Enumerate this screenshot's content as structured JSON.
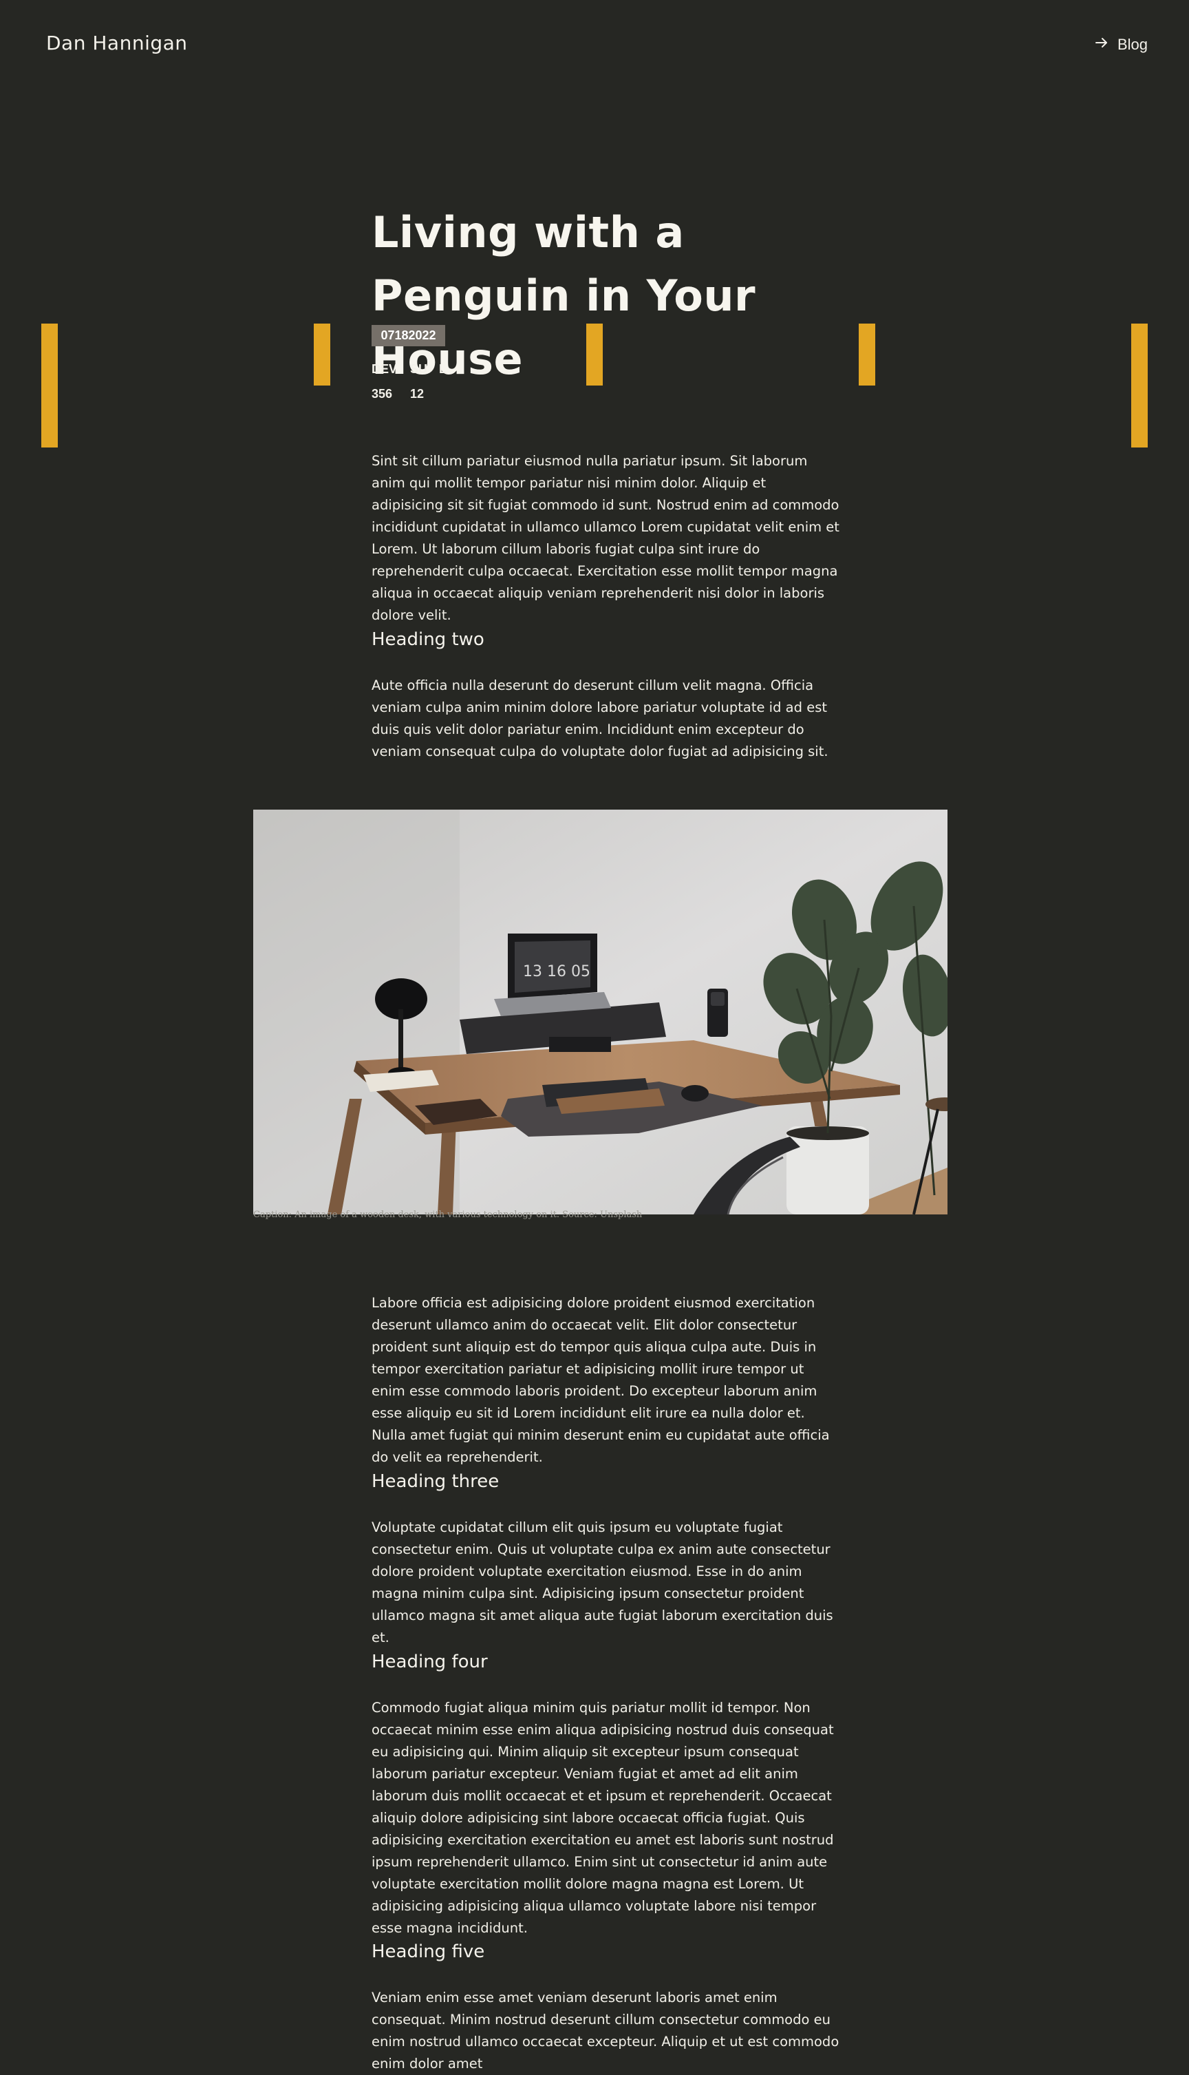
{
  "header": {
    "site_name": "Dan Hannigan",
    "blog_link": "Blog"
  },
  "colors": {
    "background": "#262723",
    "accent": "#e3a623",
    "badge": "#767069",
    "text": "#f3f1ea"
  },
  "icons": {
    "blog_link_icon": "arrow-right-icon"
  },
  "article": {
    "title": "Living with a Penguin in Your House",
    "date_badge": "07182022",
    "meta_labels": [
      "DEV",
      "SU",
      "L"
    ],
    "meta_values": [
      "356",
      "12"
    ],
    "paragraph_1": "Sint sit cillum pariatur eiusmod nulla pariatur ipsum. Sit laborum anim qui mollit tempor pariatur nisi minim dolor. Aliquip et adipisicing sit sit fugiat commodo id sunt. Nostrud enim ad commodo incididunt cupidatat in ullamco ullamco Lorem cupidatat velit enim et Lorem. Ut laborum cillum laboris fugiat culpa sint irure do reprehenderit culpa occaecat. Exercitation esse mollit tempor magna aliqua in occaecat aliquip veniam reprehenderit nisi dolor in laboris dolore velit.",
    "heading_two": "Heading two",
    "paragraph_2": "Aute officia nulla deserunt do deserunt cillum velit magna. Officia veniam culpa anim minim dolore labore pariatur voluptate id ad est duis quis velit dolor pariatur enim. Incididunt enim excepteur do veniam consequat culpa do voluptate dolor fugiat ad adipisicing sit.",
    "image_caption": "Caption: An image of a wooden desk, with various technology on it. Source: Unsplash",
    "image_clock": "13 16 05",
    "paragraph_3": "Labore officia est adipisicing dolore proident eiusmod exercitation deserunt ullamco anim do occaecat velit. Elit dolor consectetur proident sunt aliquip est do tempor quis aliqua culpa aute. Duis in tempor exercitation pariatur et adipisicing mollit irure tempor ut enim esse commodo laboris proident. Do excepteur laborum anim esse aliquip eu sit id Lorem incididunt elit irure ea nulla dolor et. Nulla amet fugiat qui minim deserunt enim eu cupidatat aute officia do velit ea reprehenderit.",
    "heading_three": "Heading three",
    "paragraph_4": "Voluptate cupidatat cillum elit quis ipsum eu voluptate fugiat consectetur enim. Quis ut voluptate culpa ex anim aute consectetur dolore proident voluptate exercitation eiusmod. Esse in do anim magna minim culpa sint. Adipisicing ipsum consectetur proident ullamco magna sit amet aliqua aute fugiat laborum exercitation duis et.",
    "heading_four": "Heading four",
    "paragraph_5": "Commodo fugiat aliqua minim quis pariatur mollit id tempor. Non occaecat minim esse enim aliqua adipisicing nostrud duis consequat eu adipisicing qui. Minim aliquip sit excepteur ipsum consequat laborum pariatur excepteur. Veniam fugiat et amet ad elit anim laborum duis mollit occaecat et et ipsum et reprehenderit. Occaecat aliquip dolore adipisicing sint labore occaecat officia fugiat. Quis adipisicing exercitation exercitation eu amet est laboris sunt nostrud ipsum reprehenderit ullamco. Enim sint ut consectetur id anim aute voluptate exercitation mollit dolore magna magna est Lorem. Ut adipisicing adipisicing aliqua ullamco voluptate labore nisi tempor esse magna incididunt.",
    "heading_five": "Heading five",
    "paragraph_6": "Veniam enim esse amet veniam deserunt laboris amet enim consequat. Minim nostrud deserunt cillum consectetur commodo eu enim nostrud ullamco occaecat excepteur. Aliquip et ut est commodo enim dolor amet"
  }
}
